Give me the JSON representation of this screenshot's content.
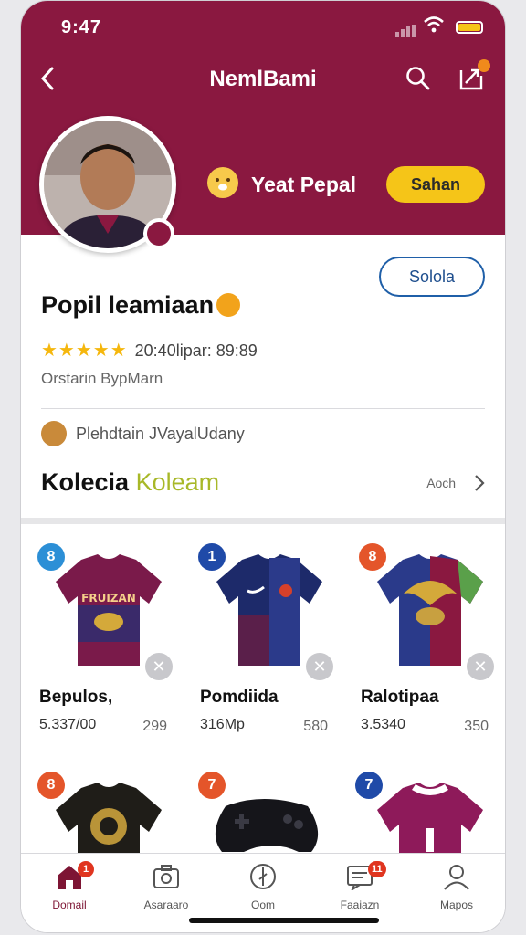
{
  "status": {
    "time": "9:47"
  },
  "topbar": {
    "title": "NemlBami"
  },
  "profile": {
    "username": "Yeat Pepal",
    "primary_button": "Sahan",
    "secondary_button": "Solola",
    "title": "Popil leamiaan",
    "stars": "★★★★★",
    "rating_text": "20:40lipar: 89:89",
    "owner": "Orstarin BypMarn",
    "follow_text": "Plehdtain JVayalUdany"
  },
  "collection": {
    "title": "Kolecia",
    "title_accent": "Koleam",
    "more": "Aoch"
  },
  "items": [
    {
      "num": "8",
      "title": "Bepulos,",
      "price": "5.337/00",
      "count": "299",
      "color": "#2c8fd6"
    },
    {
      "num": "1",
      "title": "Pomdiida",
      "price": "316Mp",
      "count": "580",
      "color": "#1f4aa8"
    },
    {
      "num": "8",
      "title": "Ralotipaa",
      "price": "3.5340",
      "count": "350",
      "color": "#e4552a"
    }
  ],
  "items_row2": [
    {
      "num": "8",
      "color": "#e4552a"
    },
    {
      "num": "7",
      "color": "#e4552a"
    },
    {
      "num": "7",
      "color": "#1f4aa8"
    }
  ],
  "tabs": [
    {
      "label": "Domail",
      "badge": "1"
    },
    {
      "label": "Asaraaro"
    },
    {
      "label": "Oom"
    },
    {
      "label": "Faaiazn",
      "badge": "11"
    },
    {
      "label": "Mapos"
    }
  ]
}
